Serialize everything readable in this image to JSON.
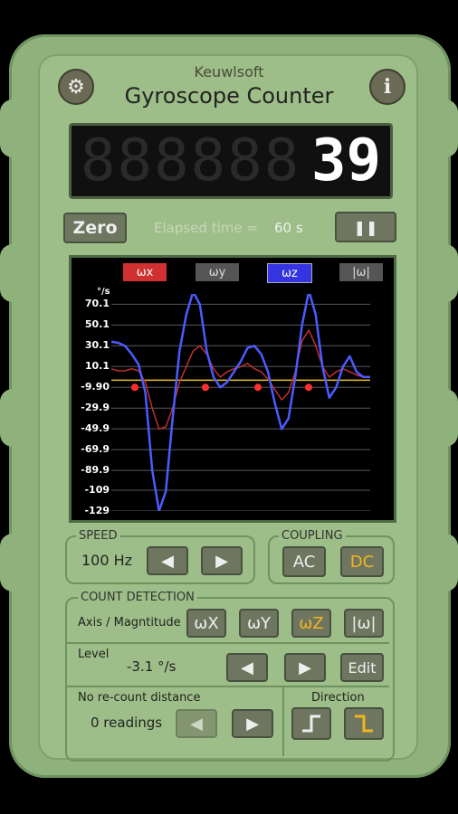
{
  "header": {
    "brand": "Keuwlsoft",
    "title": "Gyroscope Counter"
  },
  "display": {
    "ghost_digits": "888888",
    "count": "39"
  },
  "controls": {
    "zero_label": "Zero",
    "elapsed_label": "Elapsed time =",
    "elapsed_value": "60 s",
    "pause_symbol": "❚❚"
  },
  "legend": [
    "ωx",
    "ωy",
    "ωz",
    "|ω|"
  ],
  "chart_data": {
    "type": "line",
    "ylabel": "°/s",
    "yticks": [
      "70.1",
      "50.1",
      "30.1",
      "10.1",
      "-9.90",
      "-29.9",
      "-49.9",
      "-69.9",
      "-89.9",
      "-109",
      "-129"
    ],
    "ylim": [
      -129,
      80
    ],
    "level": -3.1,
    "series": [
      {
        "name": "ωz",
        "color": "#4b5bff",
        "values": [
          34,
          33,
          30,
          22,
          12,
          -15,
          -90,
          -129,
          -110,
          -40,
          25,
          60,
          82,
          70,
          25,
          0,
          -10,
          -5,
          5,
          15,
          28,
          30,
          22,
          5,
          -25,
          -50,
          -40,
          0,
          50,
          83,
          60,
          10,
          -20,
          -10,
          10,
          20,
          5,
          0,
          0
        ]
      },
      {
        "name": "ωx",
        "color": "#c03030",
        "values": [
          8,
          6,
          6,
          8,
          6,
          -5,
          -30,
          -50,
          -48,
          -30,
          -5,
          10,
          25,
          30,
          22,
          8,
          0,
          5,
          8,
          10,
          13,
          8,
          5,
          -2,
          -12,
          -22,
          -15,
          5,
          35,
          45,
          30,
          10,
          0,
          5,
          8,
          5,
          2,
          0,
          0
        ]
      }
    ],
    "markers": [
      -9.9,
      -9.9,
      -9.9,
      -9.9
    ]
  },
  "speed": {
    "label": "SPEED",
    "value": "100 Hz",
    "prev": "◀",
    "next": "▶"
  },
  "coupling": {
    "label": "COUPLING",
    "ac": "AC",
    "dc": "DC"
  },
  "count_detection": {
    "label": "COUNT DETECTION",
    "axis_label": "Axis / Magntitude",
    "axes": [
      "ωX",
      "ωY",
      "ωZ",
      "|ω|"
    ],
    "level_label": "Level",
    "level_value": "-3.1 °/s",
    "edit": "Edit",
    "prev": "◀",
    "next": "▶",
    "recount_label": "No re-count distance",
    "recount_value": "0 readings",
    "direction_label": "Direction"
  }
}
